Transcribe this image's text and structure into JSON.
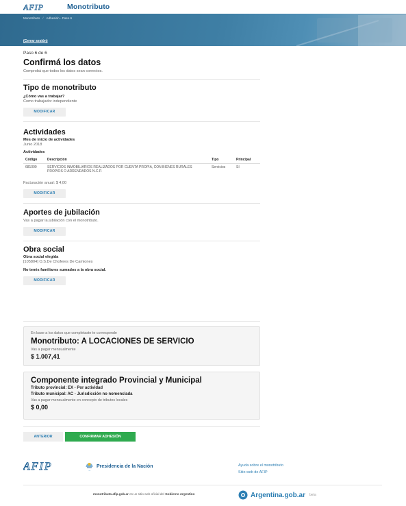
{
  "header": {
    "logo_text": "AFIP",
    "brand": "Monotributo"
  },
  "breadcrumb": {
    "items": [
      "Monotributo",
      "Adhesión - Paso 6"
    ],
    "separator": "/"
  },
  "logout": "(Cerrar sesión)",
  "page": {
    "step": "Paso 6 de 6",
    "title": "Confirmá los datos",
    "subtitle": "Comprobá que todos los datos sean correctos."
  },
  "tipo": {
    "title": "Tipo de monotributo",
    "question": "¿Cómo vas a trabajar?",
    "answer": "Como trabajador independiente",
    "button": "MODIFICAR"
  },
  "actividades": {
    "title": "Actividades",
    "mes_label": "Mes de inicio de actividades",
    "mes_value": "Junio 2018",
    "list_label": "Actividades",
    "columns": [
      "Código",
      "Descripción",
      "Tipo",
      "Principal"
    ],
    "rows": [
      {
        "codigo": "681099",
        "descripcion": "SERVICIOS INMOBILIARIOS REALIZADOS POR CUENTA PROPIA, CON BIENES RURALES PROPIOS O ARRENDADOS N.C.P.",
        "tipo": "Servicios",
        "principal": "Sí"
      }
    ],
    "facturacion": "Facturación anual: $ 4,00",
    "button": "MODIFICAR"
  },
  "jubilacion": {
    "title": "Aportes de jubilación",
    "text": "Vas a pagar la jubilación con el monotributo.",
    "button": "MODIFICAR"
  },
  "obra": {
    "title": "Obra social",
    "label": "Obra social elegida",
    "value": "[105804] O.S.De Choferes De Camiones",
    "familiares": "No tenés familiares sumados a la obra social.",
    "button": "MODIFICAR"
  },
  "card1": {
    "intro": "En base a los datos que completaste te corresponde",
    "title": "Monotributo: A LOCACIONES DE SERVICIO",
    "pay_label": "Vas a pagar mensualmente",
    "amount": "$ 1.007,41"
  },
  "card2": {
    "title": "Componente integrado Provincial y Municipal",
    "provincial": "Tributo provincial: EX - Por actividad",
    "municipal": "Tributo municipal: AC - Jurisdicción no nomenclada",
    "pay_label": "Vas a pagar mensualmente en concepto de tributos locales",
    "amount": "$ 0,00"
  },
  "actions": {
    "back": "ANTERIOR",
    "confirm": "CONFIRMAR ADHESIÓN"
  },
  "footer": {
    "logo_text": "AFIP",
    "presidencia": "Presidencia de la Nación",
    "links": [
      "Ayuda sobre el monotributo",
      "Sitio web de AFIP"
    ],
    "bottom_site": "monotributo.afip.gob.ar",
    "bottom_mid": "es un sitio web oficial del",
    "bottom_org": "Gobierno Argentino",
    "argentina": "Argentina.gob.ar",
    "beta": "beta"
  },
  "colors": {
    "accent": "#2d7fb3",
    "brand": "#1d5f93",
    "confirm": "#2faa4f",
    "hero": "#3f7fa5"
  }
}
